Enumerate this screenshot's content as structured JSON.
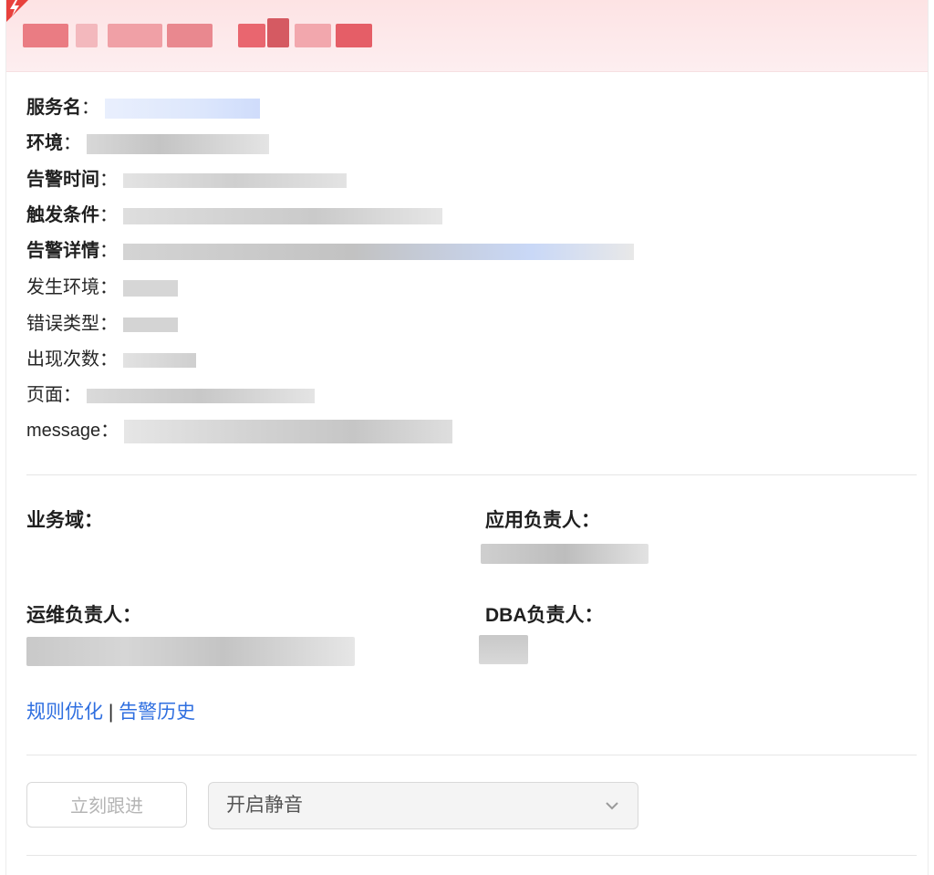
{
  "detail": {
    "service_label": "服务名",
    "env_label": "环境",
    "alert_time_label": "告警时间",
    "trigger_label": "触发条件",
    "alert_detail_label": "告警详情",
    "occur_env_label": "发生环境",
    "error_type_label": "错误类型",
    "count_label": "出现次数",
    "page_label": "页面",
    "message_label": "message",
    "colon": "："
  },
  "owners": {
    "domain_label": "业务域：",
    "app_owner_label": "应用负责人：",
    "ops_owner_label": "运维负责人：",
    "dba_owner_label": "DBA负责人："
  },
  "links": {
    "rule_optimize": "规则优化",
    "separator": " | ",
    "alert_history": "告警历史"
  },
  "actions": {
    "follow_up_label": "立刻跟进",
    "mute_selected": "开启静音"
  },
  "colors": {
    "header_bg": "#fde3e4",
    "link": "#2f6fe0",
    "corner_badge": "#e8413c"
  },
  "icons": {
    "corner": "lightning-icon",
    "select": "chevron-down-icon"
  }
}
